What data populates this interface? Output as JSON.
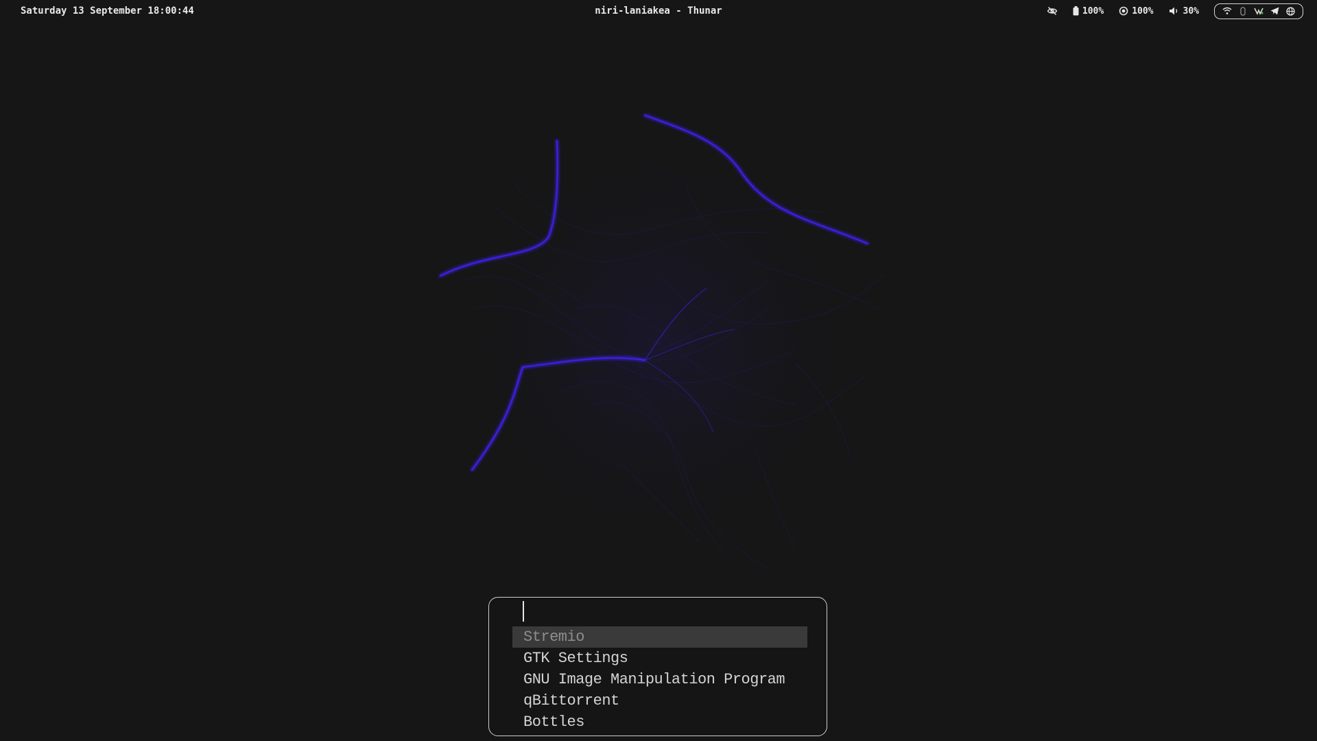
{
  "topbar": {
    "clock": "Saturday 13 September 18:00:44",
    "window_title": "niri-laniakea - Thunar",
    "status": {
      "idle_inhibit_icon": "eye-off-icon",
      "battery_icon": "battery-icon",
      "battery": "100%",
      "brightness_icon": "brightness-icon",
      "brightness": "100%",
      "volume_icon": "volume-icon",
      "volume": "30%"
    },
    "tray": [
      "wifi-icon",
      "bluetooth-icon",
      "network-tray-icon",
      "telegram-icon",
      "globe-icon"
    ]
  },
  "wallpaper": {
    "description": "abstract flow field",
    "accent_color": "#3a1fe0"
  },
  "launcher": {
    "query": "",
    "placeholder": "",
    "results": [
      {
        "label": "Stremio",
        "selected": true
      },
      {
        "label": "GTK Settings",
        "selected": false
      },
      {
        "label": "GNU Image Manipulation Program",
        "selected": false
      },
      {
        "label": "qBittorrent",
        "selected": false
      },
      {
        "label": "Bottles",
        "selected": false
      }
    ]
  },
  "colors": {
    "background": "#161616",
    "text": "#e6e6e6",
    "selection_bg": "#3a3a3a",
    "selection_text": "#8d8d8d",
    "border": "#cfcfcf"
  }
}
